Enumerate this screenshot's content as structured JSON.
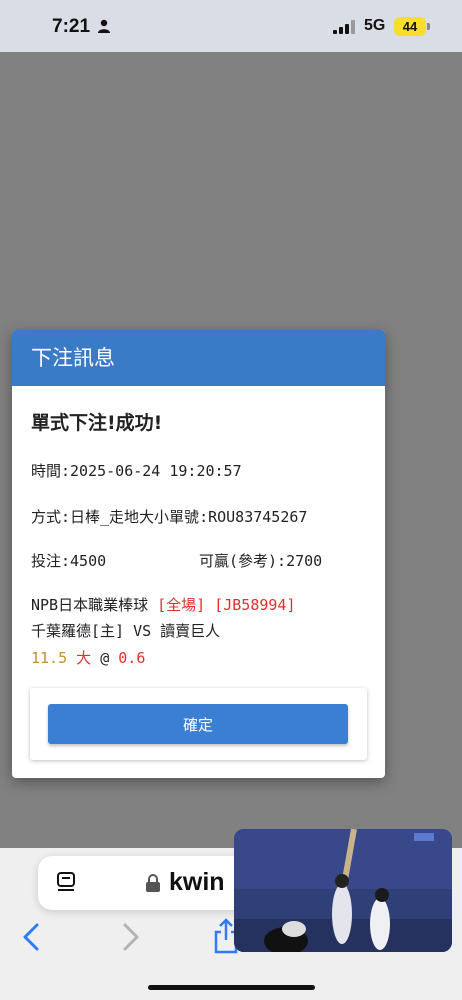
{
  "status_bar": {
    "time": "7:21",
    "network": "5G",
    "battery": "44"
  },
  "dialog": {
    "title": "下注訊息",
    "result": "單式下注!成功!",
    "time_line": "時間:2025-06-24 19:20:57",
    "method_line": "方式:日棒_走地大小單號:ROU83745267",
    "stake_line": "投注:4500",
    "payout_line": "可贏(參考):2700",
    "league": "NPB日本職業棒球",
    "scope_tag": "[全場]",
    "bet_id": "[JB58994]",
    "matchup": "千葉羅德[主] VS 讀賣巨人",
    "line_value": "11.5",
    "selection": "大",
    "at_sign": "@",
    "odds": "0.6",
    "confirm_label": "確定"
  },
  "browser": {
    "url": "kwin"
  },
  "colors": {
    "header": "#3a7bc8",
    "button": "#3b7fd4",
    "red": "#e0302f",
    "gold": "#c3922b",
    "battery": "#f7dd2c"
  },
  "icons": {
    "reader": "reader-icon",
    "lock": "lock-icon",
    "back": "chevron-left-icon",
    "forward": "chevron-right-icon",
    "share": "share-icon"
  }
}
